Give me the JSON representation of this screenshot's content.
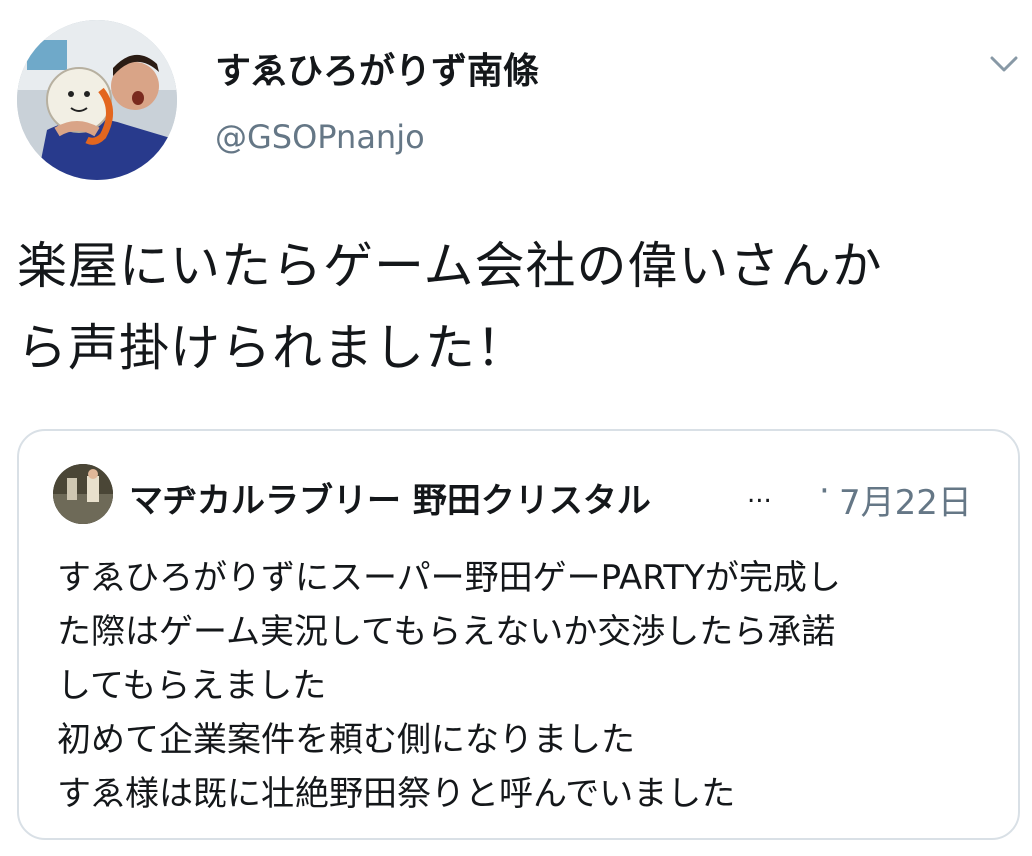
{
  "author": {
    "display_name": "すゑひろがりず南條",
    "handle": "@GSOPnanjo",
    "avatar_icon": "profile-photo"
  },
  "menu": {
    "caret_icon": "chevron-down-icon"
  },
  "tweet": {
    "lines": [
      "楽屋にいたらゲーム会社の偉いさんか",
      "ら声掛けられました！"
    ]
  },
  "quoted_tweet": {
    "display_name": "マヂカルラブリー 野田クリスタル",
    "ellipsis": "...",
    "separator": "·",
    "date": "7月22日",
    "lines": [
      "すゑひろがりずにスーパー野田ゲーPARTYが完成し",
      "た際はゲーム実況してもらえないか交渉したら承諾",
      "してもらえました",
      "初めて企業案件を頼む側になりました",
      "すゑ様は既に壮絶野田祭りと呼んでいました"
    ]
  },
  "colors": {
    "text": "#14171a",
    "secondary": "#657786",
    "border": "#d9e0e6"
  }
}
